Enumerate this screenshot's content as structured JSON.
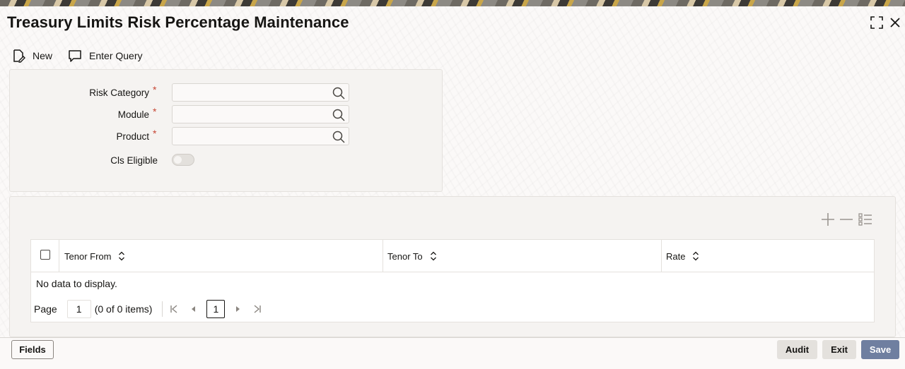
{
  "window": {
    "title": "Treasury Limits Risk Percentage Maintenance"
  },
  "toolbar": {
    "new_label": "New",
    "enter_query_label": "Enter Query"
  },
  "form": {
    "risk_category": {
      "label": "Risk Category",
      "required_mark": "*",
      "value": ""
    },
    "module": {
      "label": "Module",
      "required_mark": "*",
      "value": ""
    },
    "product": {
      "label": "Product",
      "required_mark": "*",
      "value": ""
    },
    "cls_eligible": {
      "label": "Cls Eligible",
      "checked": false
    }
  },
  "grid": {
    "columns": [
      "Tenor From",
      "Tenor To",
      "Rate"
    ],
    "empty_message": "No data to display.",
    "pager": {
      "page_label": "Page",
      "page_value": "1",
      "items_text": "(0 of 0 items)",
      "current_page": "1"
    }
  },
  "footer": {
    "fields_label": "Fields",
    "audit_label": "Audit",
    "exit_label": "Exit",
    "save_label": "Save"
  },
  "colors": {
    "save_button_bg": "#6f7fa0",
    "required_mark": "#c74634"
  },
  "icons": {
    "new": "document-edit-icon",
    "enter_query": "chat-bubble-icon",
    "lookup": "search-icon",
    "maximize": "expand-icon",
    "close": "close-icon",
    "add_row": "plus-icon",
    "delete_row": "minus-icon",
    "single_view": "list-icon",
    "sort": "sort-icon"
  }
}
